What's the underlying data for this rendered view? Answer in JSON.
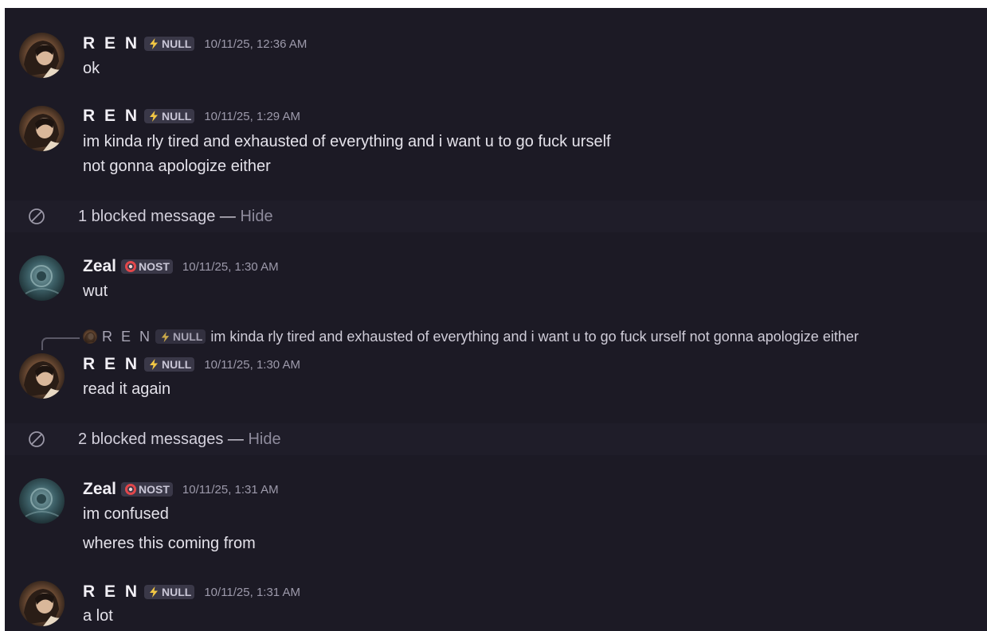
{
  "colors": {
    "background": "#1c1a25",
    "null_bolt": "#f2c744",
    "nost_ring": "#e2474b"
  },
  "messages": [
    {
      "author": "R E N",
      "tag": "NULL",
      "tag_icon": "lightning-bolt-icon",
      "timestamp": "10/11/25, 12:36 AM",
      "lines": [
        "ok"
      ]
    },
    {
      "author": "R E N",
      "tag": "NULL",
      "tag_icon": "lightning-bolt-icon",
      "timestamp": "10/11/25, 1:29 AM",
      "lines": [
        "im kinda rly tired and exhausted of everything and i want u to go fuck urself",
        "not gonna apologize either"
      ]
    },
    {
      "author": "Zeal",
      "tag": "NOST",
      "tag_icon": "red-ring-icon",
      "timestamp": "10/11/25, 1:30 AM",
      "lines": [
        "wut"
      ]
    },
    {
      "author": "R E N",
      "tag": "NULL",
      "tag_icon": "lightning-bolt-icon",
      "timestamp": "10/11/25, 1:30 AM",
      "lines": [
        "read it again"
      ],
      "reply": {
        "author": "R E N",
        "tag": "NULL",
        "text": "im kinda rly tired and exhausted of everything and i want u to go fuck urself  not gonna apologize either"
      }
    },
    {
      "author": "Zeal",
      "tag": "NOST",
      "tag_icon": "red-ring-icon",
      "timestamp": "10/11/25, 1:31 AM",
      "lines": [
        "im confused",
        "wheres this coming from"
      ]
    },
    {
      "author": "R E N",
      "tag": "NULL",
      "tag_icon": "lightning-bolt-icon",
      "timestamp": "10/11/25, 1:31 AM",
      "lines": [
        "a lot"
      ]
    }
  ],
  "blocked": [
    {
      "text": "1 blocked message — ",
      "action": "Hide",
      "icon": "blocked-circle-icon"
    },
    {
      "text": "2 blocked messages — ",
      "action": "Hide",
      "icon": "blocked-circle-icon"
    }
  ]
}
